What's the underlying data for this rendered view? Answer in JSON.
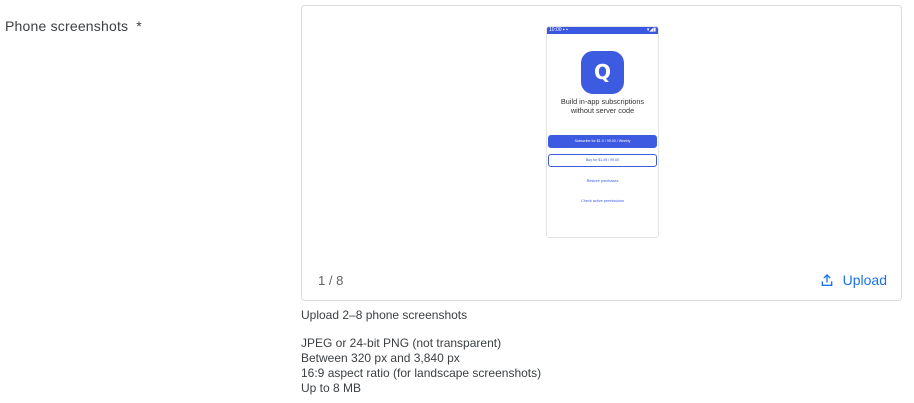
{
  "field": {
    "label": "Phone screenshots",
    "required_marker": "*"
  },
  "preview": {
    "status_left": "10:00 ▪ ▪",
    "status_right": "▾◢▮",
    "logo_letter": "Q",
    "title_line1": "Build in-app subscriptions",
    "title_line2": "without server code",
    "primary_button": "Subscribe for $1.0 / 99.00 / Weekly",
    "secondary_button": "Buy for $1.49 / 99.00",
    "link_restore": "Restore purchases",
    "link_check": "Check active permissions"
  },
  "card": {
    "counter": "1 / 8",
    "upload_label": "Upload",
    "upload_icon": "upload-icon"
  },
  "helper": {
    "text": "Upload 2–8 phone screenshots"
  },
  "requirements": [
    "JPEG or 24-bit PNG (not transparent)",
    "Between 320 px and 3,840 px",
    "16:9 aspect ratio (for landscape screenshots)",
    "Up to 8 MB"
  ],
  "colors": {
    "accent": "#1a73e8",
    "app_brand": "#3d5be0",
    "border": "#dadce0",
    "secondary_text": "#5f6368"
  }
}
